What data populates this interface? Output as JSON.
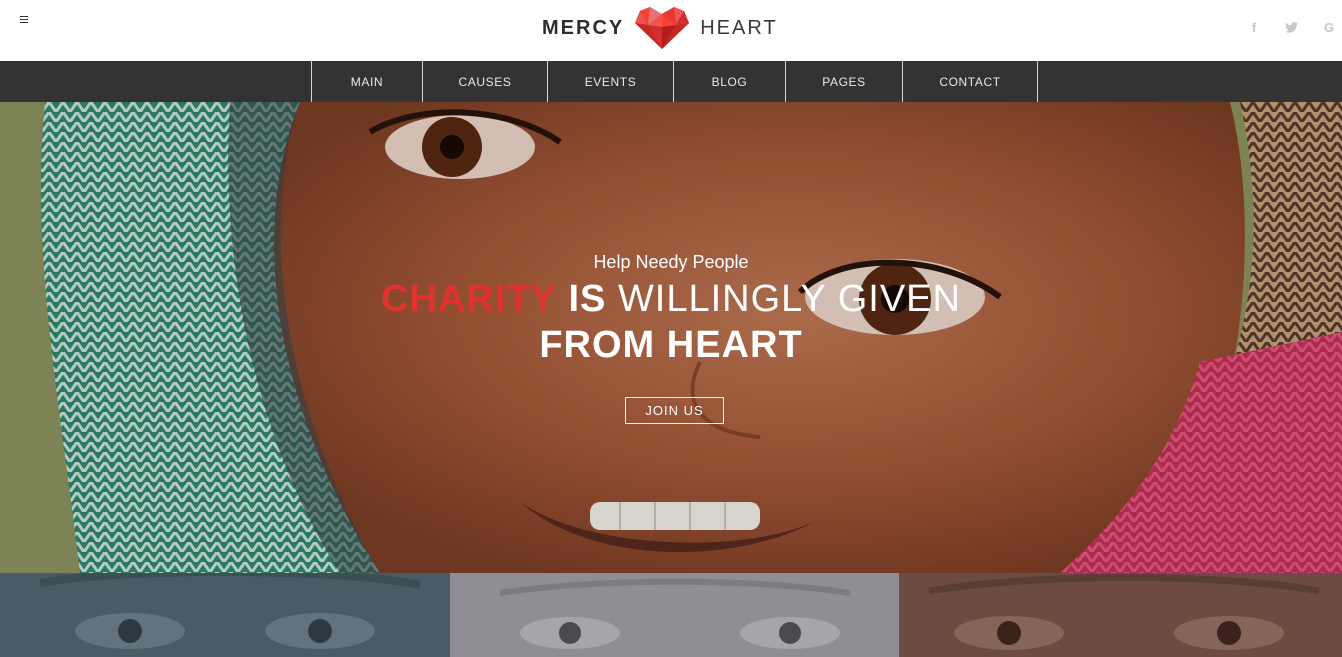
{
  "header": {
    "logo": {
      "word_left": "MERCY",
      "word_right": "HEART",
      "heart_color": "#e53935"
    },
    "menu_icon": "hamburger-icon",
    "social": [
      {
        "name": "facebook-icon",
        "glyph": "f"
      },
      {
        "name": "twitter-icon",
        "glyph": "🐦"
      },
      {
        "name": "google-plus-icon",
        "glyph": "G"
      }
    ]
  },
  "nav": {
    "items": [
      {
        "label": "MAIN"
      },
      {
        "label": "CAUSES"
      },
      {
        "label": "EVENTS"
      },
      {
        "label": "BLOG"
      },
      {
        "label": "PAGES"
      },
      {
        "label": "CONTACT"
      }
    ],
    "background": "#333333"
  },
  "hero": {
    "subtitle": "Help Needy People",
    "headline_red": "CHARITY",
    "headline_bold": "IS",
    "headline_light": "WILLINGLY GIVEN",
    "headline_line2": "FROM HEART",
    "button_label": "JOIN US",
    "accent": "#e0322f"
  },
  "panels": {
    "colors": [
      "#4c5a66",
      "#8f8e95",
      "#6d4b43"
    ]
  }
}
